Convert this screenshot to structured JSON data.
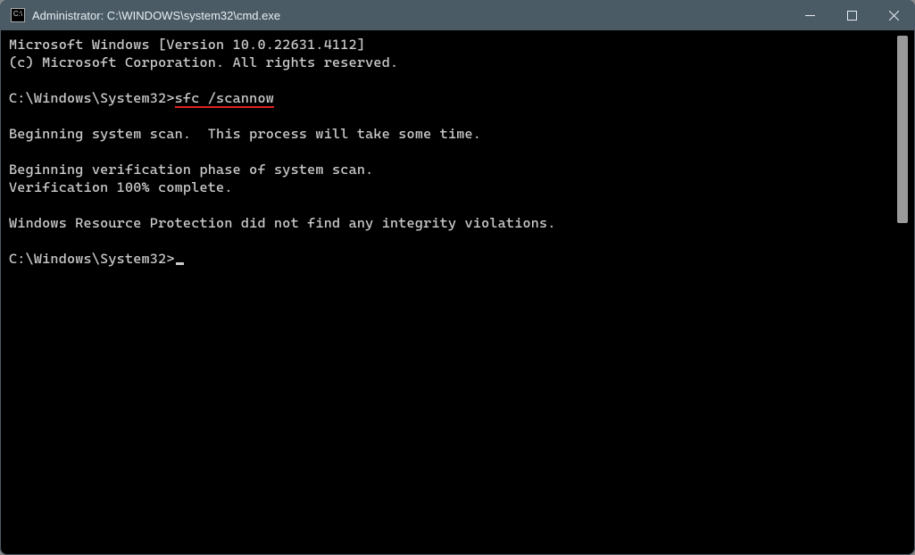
{
  "titlebar": {
    "icon_label": "C:\\",
    "title": "Administrator: C:\\WINDOWS\\system32\\cmd.exe"
  },
  "terminal": {
    "line1": "Microsoft Windows [Version 10.0.22631.4112]",
    "line2": "(c) Microsoft Corporation. All rights reserved.",
    "prompt1_path": "C:\\Windows\\System32>",
    "prompt1_cmd": "sfc /scannow",
    "line_scan": "Beginning system scan.  This process will take some time.",
    "line_verif1": "Beginning verification phase of system scan.",
    "line_verif2": "Verification 100% complete.",
    "line_result": "Windows Resource Protection did not find any integrity violations.",
    "prompt2_path": "C:\\Windows\\System32>"
  }
}
